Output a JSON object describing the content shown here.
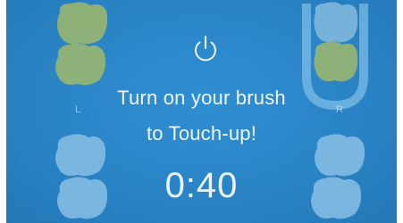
{
  "prompt": {
    "line1": "Turn on your brush",
    "line2": "to Touch-up!"
  },
  "timer": "0:40",
  "side_labels": {
    "left": "L",
    "right": "R"
  },
  "icons": {
    "power": "power-icon"
  },
  "colors": {
    "background": "#2a84c6",
    "highlight_teeth": "#9fb86a",
    "inactive_teeth": "#8fc3e6",
    "selected_outline": "#9ccfee"
  }
}
